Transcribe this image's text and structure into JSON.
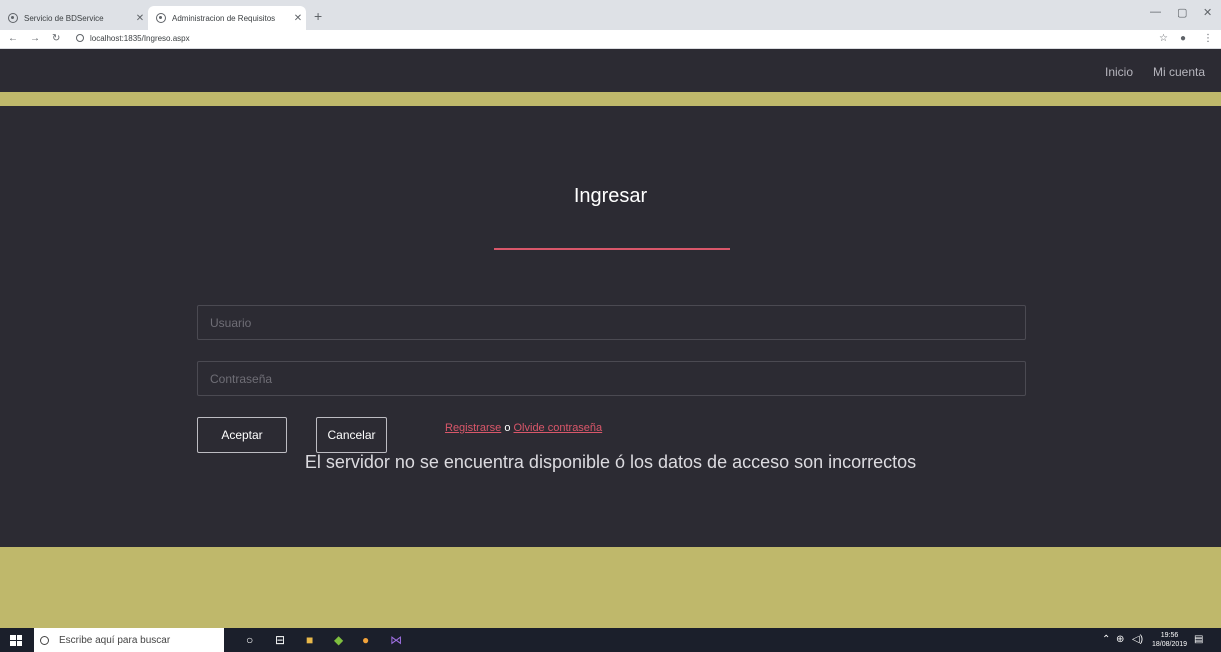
{
  "browser": {
    "tabs": [
      {
        "title": "Servicio de BDService",
        "active": false
      },
      {
        "title": "Administracion de Requisitos",
        "active": true
      }
    ],
    "new_tab_label": "+",
    "url": "localhost:1835/Ingreso.aspx"
  },
  "site": {
    "nav": {
      "home": "Inicio",
      "account": "Mi cuenta"
    },
    "login": {
      "title": "Ingresar",
      "username_placeholder": "Usuario",
      "password_placeholder": "Contraseña",
      "accept_label": "Aceptar",
      "cancel_label": "Cancelar",
      "register_link": "Registrarse",
      "separator": "o",
      "forgot_link": "Olvide contraseña",
      "error_message": "El servidor no se encuentra disponible ó los datos de acceso son incorrectos"
    },
    "colors": {
      "background": "#2c2b33",
      "accent_gold": "#bfb86b",
      "accent_red": "#d9576a"
    }
  },
  "taskbar": {
    "search_placeholder": "Escribe aquí para buscar",
    "time": "19:56",
    "date": "18/08/2019"
  }
}
